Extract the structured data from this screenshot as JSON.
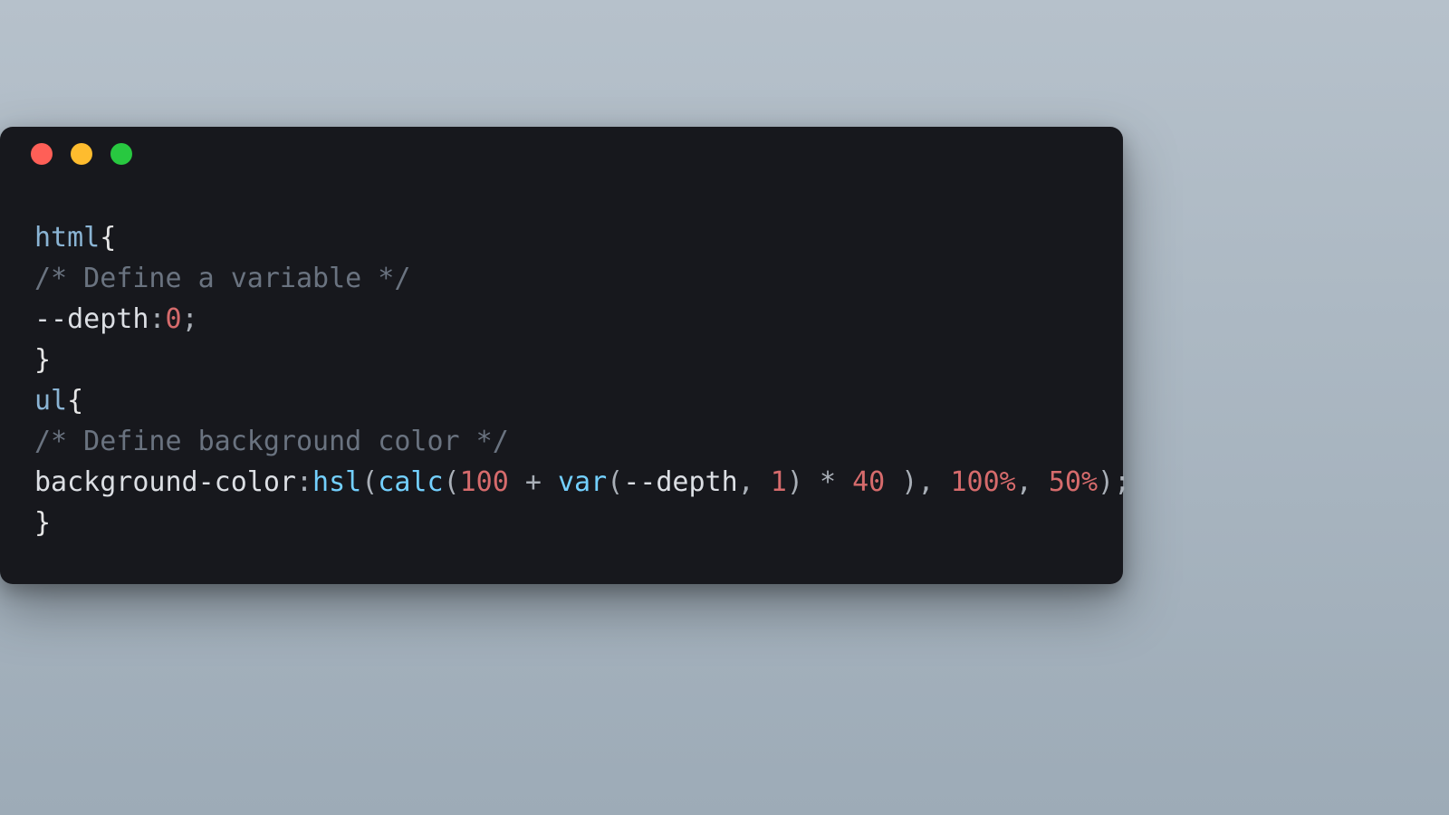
{
  "window": {
    "buttons": {
      "close": "close",
      "minimize": "minimize",
      "zoom": "zoom"
    }
  },
  "code": {
    "lines": [
      [
        {
          "cls": "tok-selector",
          "text": "html"
        },
        {
          "cls": "tok-brace",
          "text": "{"
        }
      ],
      [
        {
          "cls": "tok-comment",
          "text": "/* Define a variable */"
        }
      ],
      [
        {
          "cls": "tok-property",
          "text": "--depth"
        },
        {
          "cls": "tok-punct",
          "text": ":"
        },
        {
          "cls": "tok-number",
          "text": "0"
        },
        {
          "cls": "tok-punct",
          "text": ";"
        }
      ],
      [
        {
          "cls": "tok-brace",
          "text": "}"
        }
      ],
      [
        {
          "cls": "tok-selector",
          "text": "ul"
        },
        {
          "cls": "tok-brace",
          "text": "{"
        }
      ],
      [
        {
          "cls": "tok-comment",
          "text": "/* Define background color */"
        }
      ],
      [
        {
          "cls": "tok-property",
          "text": "background-color"
        },
        {
          "cls": "tok-punct",
          "text": ":"
        },
        {
          "cls": "tok-func",
          "text": "hsl"
        },
        {
          "cls": "tok-punct",
          "text": "("
        },
        {
          "cls": "tok-func",
          "text": "calc"
        },
        {
          "cls": "tok-punct",
          "text": "("
        },
        {
          "cls": "tok-number",
          "text": "100"
        },
        {
          "cls": "tok-op",
          "text": " + "
        },
        {
          "cls": "tok-func",
          "text": "var"
        },
        {
          "cls": "tok-punct",
          "text": "("
        },
        {
          "cls": "tok-var",
          "text": "--depth"
        },
        {
          "cls": "tok-punct",
          "text": ", "
        },
        {
          "cls": "tok-number",
          "text": "1"
        },
        {
          "cls": "tok-punct",
          "text": ") "
        },
        {
          "cls": "tok-op",
          "text": "* "
        },
        {
          "cls": "tok-number",
          "text": "40"
        },
        {
          "cls": "tok-punct",
          "text": " ), "
        },
        {
          "cls": "tok-number",
          "text": "100"
        },
        {
          "cls": "tok-pct",
          "text": "%"
        },
        {
          "cls": "tok-punct",
          "text": ", "
        },
        {
          "cls": "tok-number",
          "text": "50"
        },
        {
          "cls": "tok-pct",
          "text": "%"
        },
        {
          "cls": "tok-punct",
          "text": ");"
        }
      ],
      [
        {
          "cls": "tok-brace",
          "text": "}"
        }
      ]
    ]
  }
}
